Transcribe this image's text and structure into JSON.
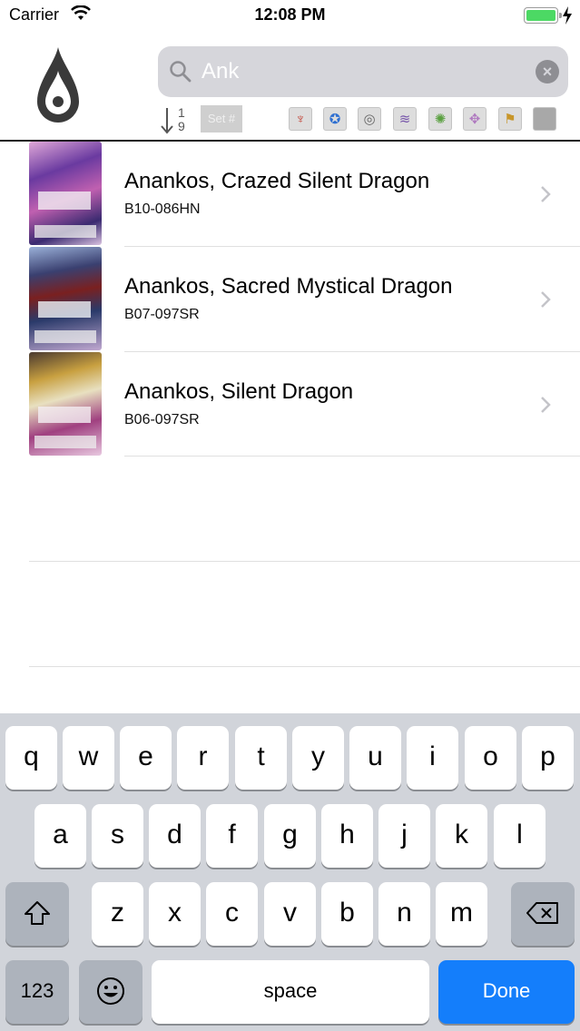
{
  "status_bar": {
    "carrier": "Carrier",
    "time": "12:08 PM",
    "battery_color": "#4cd964"
  },
  "header": {
    "logo_icon": "drop-logo-icon",
    "search": {
      "value": "Ank",
      "search_icon": "search-icon",
      "clear_icon": "clear-circle-icon"
    },
    "sort": {
      "top_digit": "1",
      "bottom_digit": "9",
      "icon": "sort-down-arrow-icon"
    },
    "set_button_label": "Set #",
    "filters": [
      {
        "icon": "red-faction-icon",
        "color": "#c0392b"
      },
      {
        "icon": "blue-faction-icon",
        "color": "#2e6fd1"
      },
      {
        "icon": "white-faction-icon",
        "color": "#777777"
      },
      {
        "icon": "black-faction-icon",
        "color": "#7755aa"
      },
      {
        "icon": "green-faction-icon",
        "color": "#5aa040"
      },
      {
        "icon": "purple-faction-icon",
        "color": "#b07ac0"
      },
      {
        "icon": "yellow-faction-icon",
        "color": "#c8962a"
      },
      {
        "icon": "colorless-faction-icon",
        "color": "#9a9a9a"
      }
    ]
  },
  "results": [
    {
      "name": "Anankos, Crazed Silent Dragon",
      "code": "B10-086HN"
    },
    {
      "name": "Anankos, Sacred Mystical Dragon",
      "code": "B07-097SR"
    },
    {
      "name": "Anankos, Silent Dragon",
      "code": "B06-097SR"
    }
  ],
  "keyboard": {
    "row1": [
      "q",
      "w",
      "e",
      "r",
      "t",
      "y",
      "u",
      "i",
      "o",
      "p"
    ],
    "row2": [
      "a",
      "s",
      "d",
      "f",
      "g",
      "h",
      "j",
      "k",
      "l"
    ],
    "row3": [
      "z",
      "x",
      "c",
      "v",
      "b",
      "n",
      "m"
    ],
    "shift_icon": "shift-icon",
    "delete_icon": "delete-icon",
    "numbers_label": "123",
    "emoji_icon": "emoji-icon",
    "space_label": "space",
    "done_label": "Done"
  }
}
